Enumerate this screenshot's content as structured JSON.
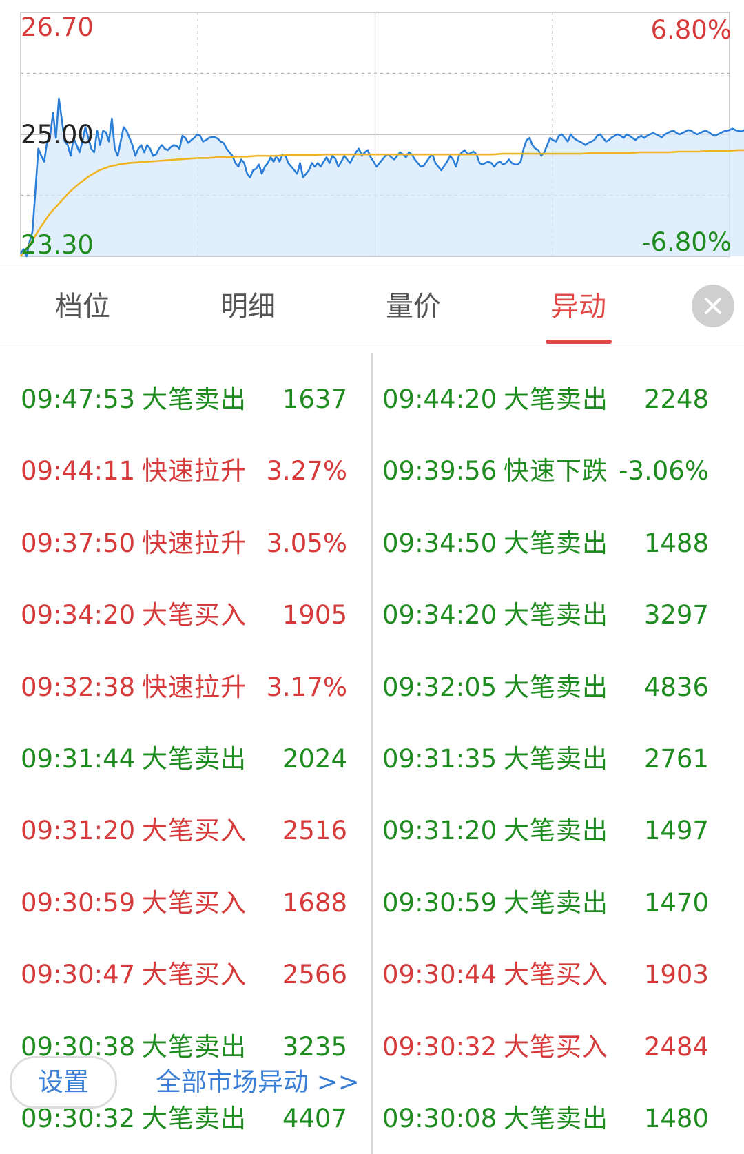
{
  "chart_data": {
    "type": "line",
    "y_axis_left": {
      "max_label": "26.70",
      "mid_label": "25.00",
      "min_label": "23.30"
    },
    "y_axis_right": {
      "max_label": "6.80%",
      "min_label": "-6.80%"
    },
    "ylim": [
      23.3,
      26.7
    ],
    "grid": true,
    "colors": {
      "price": "#2b7ed8",
      "avg": "#f0b323",
      "fill": "#d7e9fb",
      "up": "#d63a3a",
      "down": "#1f8c1f"
    },
    "series": [
      {
        "key": "price",
        "values": [
          23.34,
          23.4,
          23.3,
          23.5,
          23.64,
          24.2,
          24.8,
          24.7,
          24.62,
          24.9,
          24.98,
          25.3,
          24.95,
          25.5,
          25.2,
          24.9,
          24.85,
          24.7,
          24.95,
          24.85,
          24.75,
          24.9,
          25.1,
          24.95,
          24.8,
          24.75,
          25.05,
          24.85,
          25.05,
          25.03,
          24.9,
          25.22,
          24.8,
          24.7,
          24.9,
          25.1,
          25.05,
          24.95,
          24.85,
          24.7,
          24.8,
          24.85,
          24.75,
          24.85,
          24.8,
          24.7,
          24.72,
          24.8,
          24.85,
          24.8,
          24.78,
          24.82,
          24.85,
          24.84,
          24.8,
          24.98,
          24.95,
          24.88,
          24.92,
          24.95,
          25.0,
          24.98,
          24.9,
          24.92,
          24.95,
          24.96,
          24.96,
          24.94,
          24.9,
          24.88,
          24.8,
          24.75,
          24.7,
          24.6,
          24.55,
          24.65,
          24.6,
          24.45,
          24.4,
          24.5,
          24.52,
          24.58,
          24.45,
          24.55,
          24.6,
          24.68,
          24.62,
          24.7,
          24.62,
          24.72,
          24.7,
          24.6,
          24.55,
          24.5,
          24.45,
          24.6,
          24.4,
          24.45,
          24.5,
          24.6,
          24.55,
          24.6,
          24.55,
          24.62,
          24.68,
          24.6,
          24.7,
          24.66,
          24.55,
          24.62,
          24.7,
          24.65,
          24.6,
          24.68,
          24.75,
          24.8,
          24.7,
          24.75,
          24.78,
          24.68,
          24.62,
          24.55,
          24.6,
          24.65,
          24.7,
          24.72,
          24.68,
          24.65,
          24.7,
          24.75,
          24.72,
          24.68,
          24.75,
          24.72,
          24.65,
          24.6,
          24.55,
          24.56,
          24.62,
          24.68,
          24.72,
          24.6,
          24.55,
          24.5,
          24.56,
          24.62,
          24.7,
          24.65,
          24.55,
          24.7,
          24.75,
          24.78,
          24.72,
          24.74,
          24.76,
          24.72,
          24.6,
          24.58,
          24.6,
          24.62,
          24.6,
          24.55,
          24.6,
          24.62,
          24.58,
          24.6,
          24.65,
          24.6,
          24.58,
          24.58,
          24.62,
          24.8,
          24.92,
          24.95,
          24.85,
          24.8,
          24.78,
          24.7,
          24.75,
          24.85,
          24.95,
          24.92,
          24.9,
          24.98,
          25.0,
          24.95,
          24.9,
          25.0,
          24.95,
          24.92,
          24.9,
          24.88,
          24.85,
          24.88,
          24.9,
          24.92,
          24.98,
          25.0,
          24.95,
          24.9,
          24.92,
          24.96,
          24.98,
          25.0,
          24.98,
          24.95,
          25.0,
          24.98,
          24.95,
          24.92,
          24.96,
          24.98,
          24.95,
          24.98,
          25.0,
          25.02,
          25.0,
          24.98,
          24.96,
          25.0,
          25.02,
          25.04,
          25.05,
          25.02,
          25.0,
          25.02,
          25.04,
          25.06,
          25.05,
          25.02,
          25.0,
          25.02,
          25.04,
          25.05,
          25.03,
          25.0,
          24.98,
          25.0,
          25.02,
          25.04,
          25.05,
          25.06,
          25.08,
          25.06,
          25.05,
          25.04,
          25.06,
          25.08,
          25.1,
          25.08,
          25.06,
          25.05,
          25.04,
          25.03,
          25.02
        ]
      },
      {
        "key": "avg",
        "values": [
          23.3,
          23.48,
          23.7,
          23.9,
          24.05,
          24.2,
          24.32,
          24.42,
          24.5,
          24.55,
          24.58,
          24.6,
          24.61,
          24.62,
          24.63,
          24.64,
          24.65,
          24.66,
          24.67,
          24.67,
          24.68,
          24.68,
          24.69,
          24.69,
          24.7,
          24.7,
          24.7,
          24.71,
          24.71,
          24.71,
          24.71,
          24.72,
          24.72,
          24.72,
          24.72,
          24.72,
          24.72,
          24.72,
          24.72,
          24.72,
          24.72,
          24.72,
          24.72,
          24.72,
          24.72,
          24.72,
          24.72,
          24.72,
          24.72,
          24.73,
          24.73,
          24.73,
          24.73,
          24.73,
          24.73,
          24.73,
          24.73,
          24.73,
          24.74,
          24.74,
          24.74,
          24.74,
          24.74,
          24.75,
          24.75,
          24.75,
          24.75,
          24.76,
          24.76,
          24.76,
          24.77,
          24.77,
          24.77,
          24.78,
          24.78,
          24.79,
          24.8
        ]
      }
    ]
  },
  "tabs": [
    "档位",
    "明细",
    "量价",
    "异动"
  ],
  "active_tab": "异动",
  "close_icon": "close-icon",
  "events_left": [
    {
      "time": "09:47:53",
      "event": "大笔卖出",
      "value": "1637",
      "dir": "down"
    },
    {
      "time": "09:44:11",
      "event": "快速拉升",
      "value": "3.27%",
      "dir": "up"
    },
    {
      "time": "09:37:50",
      "event": "快速拉升",
      "value": "3.05%",
      "dir": "up"
    },
    {
      "time": "09:34:20",
      "event": "大笔买入",
      "value": "1905",
      "dir": "up"
    },
    {
      "time": "09:32:38",
      "event": "快速拉升",
      "value": "3.17%",
      "dir": "up"
    },
    {
      "time": "09:31:44",
      "event": "大笔卖出",
      "value": "2024",
      "dir": "down"
    },
    {
      "time": "09:31:20",
      "event": "大笔买入",
      "value": "2516",
      "dir": "up"
    },
    {
      "time": "09:30:59",
      "event": "大笔买入",
      "value": "1688",
      "dir": "up"
    },
    {
      "time": "09:30:47",
      "event": "大笔买入",
      "value": "2566",
      "dir": "up"
    },
    {
      "time": "09:30:38",
      "event": "大笔卖出",
      "value": "3235",
      "dir": "down"
    },
    {
      "time": "09:30:32",
      "event": "大笔卖出",
      "value": "4407",
      "dir": "down"
    }
  ],
  "events_right": [
    {
      "time": "09:44:20",
      "event": "大笔卖出",
      "value": "2248",
      "dir": "down"
    },
    {
      "time": "09:39:56",
      "event": "快速下跌",
      "value": "-3.06%",
      "dir": "down"
    },
    {
      "time": "09:34:50",
      "event": "大笔卖出",
      "value": "1488",
      "dir": "down"
    },
    {
      "time": "09:34:20",
      "event": "大笔卖出",
      "value": "3297",
      "dir": "down"
    },
    {
      "time": "09:32:05",
      "event": "大笔卖出",
      "value": "4836",
      "dir": "down"
    },
    {
      "time": "09:31:35",
      "event": "大笔卖出",
      "value": "2761",
      "dir": "down"
    },
    {
      "time": "09:31:20",
      "event": "大笔卖出",
      "value": "1497",
      "dir": "down"
    },
    {
      "time": "09:30:59",
      "event": "大笔卖出",
      "value": "1470",
      "dir": "down"
    },
    {
      "time": "09:30:44",
      "event": "大笔买入",
      "value": "1903",
      "dir": "up"
    },
    {
      "time": "09:30:32",
      "event": "大笔买入",
      "value": "2484",
      "dir": "up"
    },
    {
      "time": "09:30:08",
      "event": "大笔卖出",
      "value": "1480",
      "dir": "down"
    }
  ],
  "footer": {
    "settings_label": "设置",
    "all_market_link": "全部市场异动 >>"
  }
}
